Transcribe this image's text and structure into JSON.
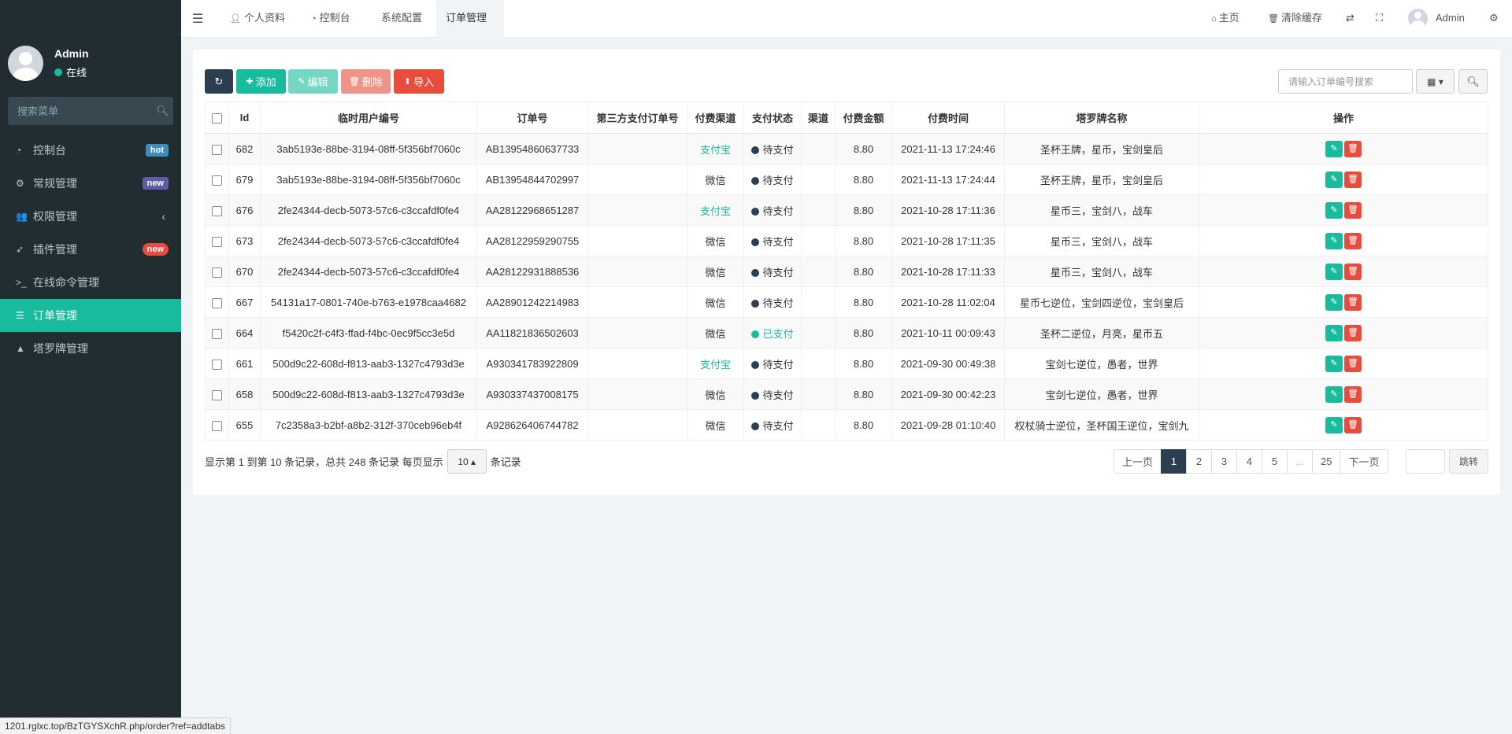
{
  "sidebar": {
    "user": {
      "name": "Admin",
      "status": "在线"
    },
    "search_placeholder": "搜索菜单",
    "items": [
      {
        "label": "控制台",
        "icon": "dashboard-icon",
        "glyph": "◔",
        "badge": "hot"
      },
      {
        "label": "常规管理",
        "icon": "cogs-icon",
        "glyph": "⚙",
        "badge": "new"
      },
      {
        "label": "权限管理",
        "icon": "group-icon",
        "glyph": "👥",
        "chevron": "‹"
      },
      {
        "label": "插件管理",
        "icon": "rocket-icon",
        "glyph": "➶",
        "badge": "new"
      },
      {
        "label": "在线命令管理",
        "icon": "terminal-icon",
        "glyph": ">_"
      },
      {
        "label": "订单管理",
        "icon": "list-icon",
        "glyph": "☰"
      },
      {
        "label": "塔罗牌管理",
        "icon": "chart-icon",
        "glyph": "▲"
      }
    ]
  },
  "header": {
    "tabs": [
      {
        "label": "个人资料",
        "icon": "user-icon",
        "glyph": "👤"
      },
      {
        "label": "控制台",
        "icon": "dashboard-icon",
        "glyph": "◔"
      },
      {
        "label": "系统配置",
        "icon": "",
        "glyph": ""
      },
      {
        "label": "订单管理",
        "icon": "",
        "glyph": ""
      }
    ],
    "right": {
      "home": "主页",
      "clear_cache": "清除缓存",
      "user": "Admin"
    }
  },
  "toolbar": {
    "add": "添加",
    "edit": "编辑",
    "delete": "删除",
    "import": "导入",
    "search_placeholder": "请输入订单编号搜索"
  },
  "table": {
    "columns": [
      "Id",
      "临时用户编号",
      "订单号",
      "第三方支付订单号",
      "付费渠道",
      "支付状态",
      "渠道",
      "付费金额",
      "付费时间",
      "塔罗牌名称",
      "操作"
    ],
    "rows": [
      {
        "id": "682",
        "user_no": "3ab5193e-88be-3194-08ff-5f356bf7060c",
        "order_no": "AB13954860637733",
        "third_no": "",
        "pay_channel": "支付宝",
        "status": "待支付",
        "channel": "",
        "amount": "8.80",
        "time": "2021-11-13 17:24:46",
        "cards": "圣杯王牌，星币，宝剑皇后"
      },
      {
        "id": "679",
        "user_no": "3ab5193e-88be-3194-08ff-5f356bf7060c",
        "order_no": "AB13954844702997",
        "third_no": "",
        "pay_channel": "微信",
        "status": "待支付",
        "channel": "",
        "amount": "8.80",
        "time": "2021-11-13 17:24:44",
        "cards": "圣杯王牌，星币，宝剑皇后"
      },
      {
        "id": "676",
        "user_no": "2fe24344-decb-5073-57c6-c3ccafdf0fe4",
        "order_no": "AA28122968651287",
        "third_no": "",
        "pay_channel": "支付宝",
        "status": "待支付",
        "channel": "",
        "amount": "8.80",
        "time": "2021-10-28 17:11:36",
        "cards": "星币三，宝剑八，战车"
      },
      {
        "id": "673",
        "user_no": "2fe24344-decb-5073-57c6-c3ccafdf0fe4",
        "order_no": "AA28122959290755",
        "third_no": "",
        "pay_channel": "微信",
        "status": "待支付",
        "channel": "",
        "amount": "8.80",
        "time": "2021-10-28 17:11:35",
        "cards": "星币三，宝剑八，战车"
      },
      {
        "id": "670",
        "user_no": "2fe24344-decb-5073-57c6-c3ccafdf0fe4",
        "order_no": "AA28122931888536",
        "third_no": "",
        "pay_channel": "微信",
        "status": "待支付",
        "channel": "",
        "amount": "8.80",
        "time": "2021-10-28 17:11:33",
        "cards": "星币三，宝剑八，战车"
      },
      {
        "id": "667",
        "user_no": "54131a17-0801-740e-b763-e1978caa4682",
        "order_no": "AA28901242214983",
        "third_no": "",
        "pay_channel": "微信",
        "status": "待支付",
        "channel": "",
        "amount": "8.80",
        "time": "2021-10-28 11:02:04",
        "cards": "星币七逆位，宝剑四逆位，宝剑皇后"
      },
      {
        "id": "664",
        "user_no": "f5420c2f-c4f3-ffad-f4bc-0ec9f5cc3e5d",
        "order_no": "AA11821836502603",
        "third_no": "",
        "pay_channel": "微信",
        "status": "已支付",
        "channel": "",
        "amount": "8.80",
        "time": "2021-10-11 00:09:43",
        "cards": "圣杯二逆位，月亮，星币五"
      },
      {
        "id": "661",
        "user_no": "500d9c22-608d-f813-aab3-1327c4793d3e",
        "order_no": "A930341783922809",
        "third_no": "",
        "pay_channel": "支付宝",
        "status": "待支付",
        "channel": "",
        "amount": "8.80",
        "time": "2021-09-30 00:49:38",
        "cards": "宝剑七逆位，愚者，世界"
      },
      {
        "id": "658",
        "user_no": "500d9c22-608d-f813-aab3-1327c4793d3e",
        "order_no": "A930337437008175",
        "third_no": "",
        "pay_channel": "微信",
        "status": "待支付",
        "channel": "",
        "amount": "8.80",
        "time": "2021-09-30 00:42:23",
        "cards": "宝剑七逆位，愚者，世界"
      },
      {
        "id": "655",
        "user_no": "7c2358a3-b2bf-a8b2-312f-370ceb96eb4f",
        "order_no": "A928626406744782",
        "third_no": "",
        "pay_channel": "微信",
        "status": "待支付",
        "channel": "",
        "amount": "8.80",
        "time": "2021-09-28 01:10:40",
        "cards": "权杖骑士逆位，圣杯国王逆位，宝剑九"
      }
    ]
  },
  "pagination": {
    "info_prefix": "显示第 1 到第 10 条记录，总共 248 条记录 每页显示",
    "page_size": "10",
    "info_suffix": "条记录",
    "prev": "上一页",
    "pages": [
      "1",
      "2",
      "3",
      "4",
      "5",
      "...",
      "25"
    ],
    "current": "1",
    "next": "下一页",
    "jump": "跳转"
  },
  "status_bar": {
    "url": "1201.rglxc.top/BzTGYSXchR.php/order?ref=addtabs"
  },
  "colors": {
    "sidebar_bg": "#222d32",
    "accent": "#18bc9c",
    "danger": "#e74c3c",
    "dark": "#2c3e50"
  }
}
